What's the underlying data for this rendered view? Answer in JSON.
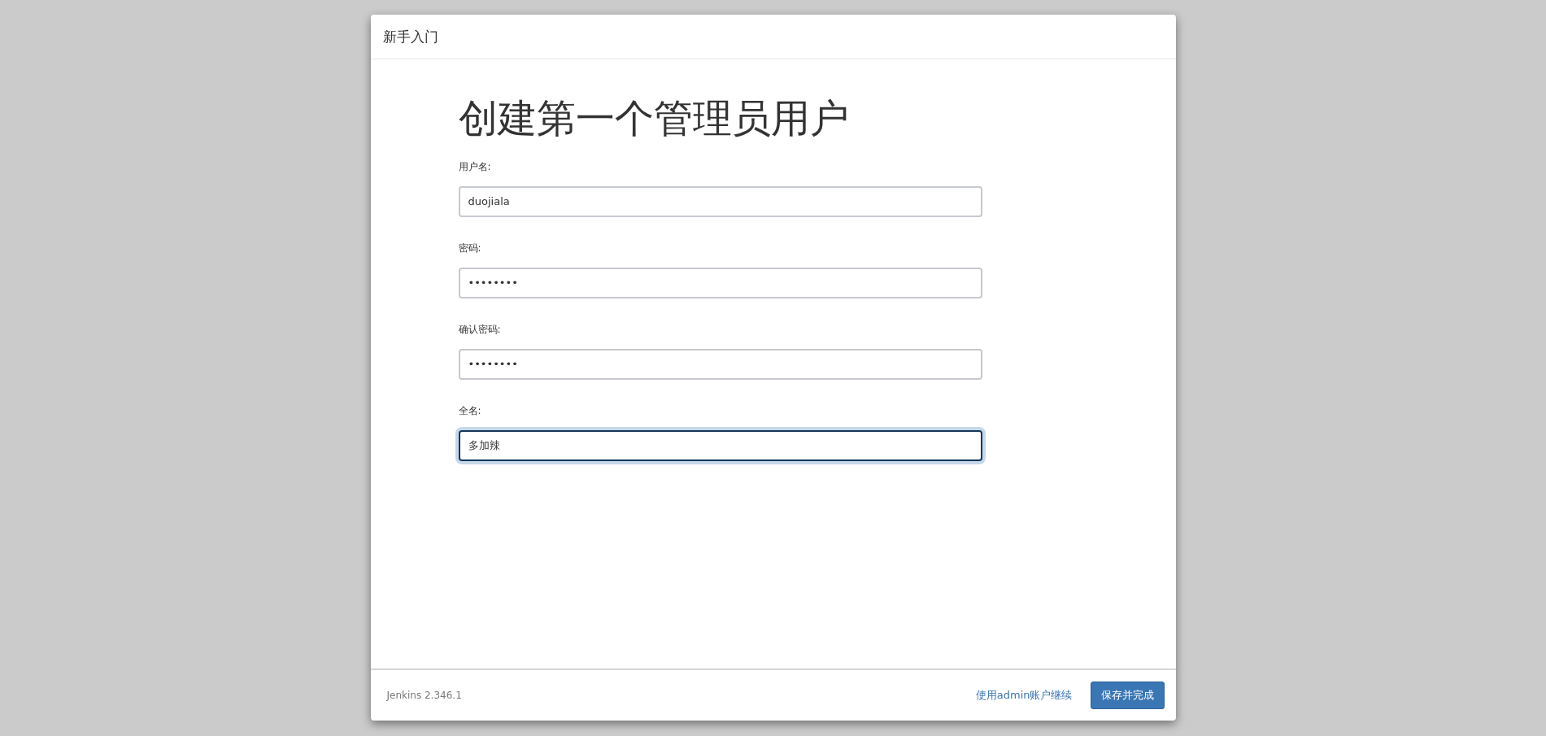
{
  "dialog": {
    "title": "新手入门"
  },
  "heading": "创建第一个管理员用户",
  "fields": [
    {
      "label": "用户名:",
      "value": "duojiala",
      "focused": false
    },
    {
      "label": "密码:",
      "value": "••••••••",
      "focused": false
    },
    {
      "label": "确认密码:",
      "value": "••••••••",
      "focused": false
    },
    {
      "label": "全名:",
      "value": "多加辣",
      "focused": true
    }
  ],
  "footer": {
    "version": "Jenkins 2.346.1",
    "link": "使用admin账户继续",
    "button": "保存并完成"
  }
}
